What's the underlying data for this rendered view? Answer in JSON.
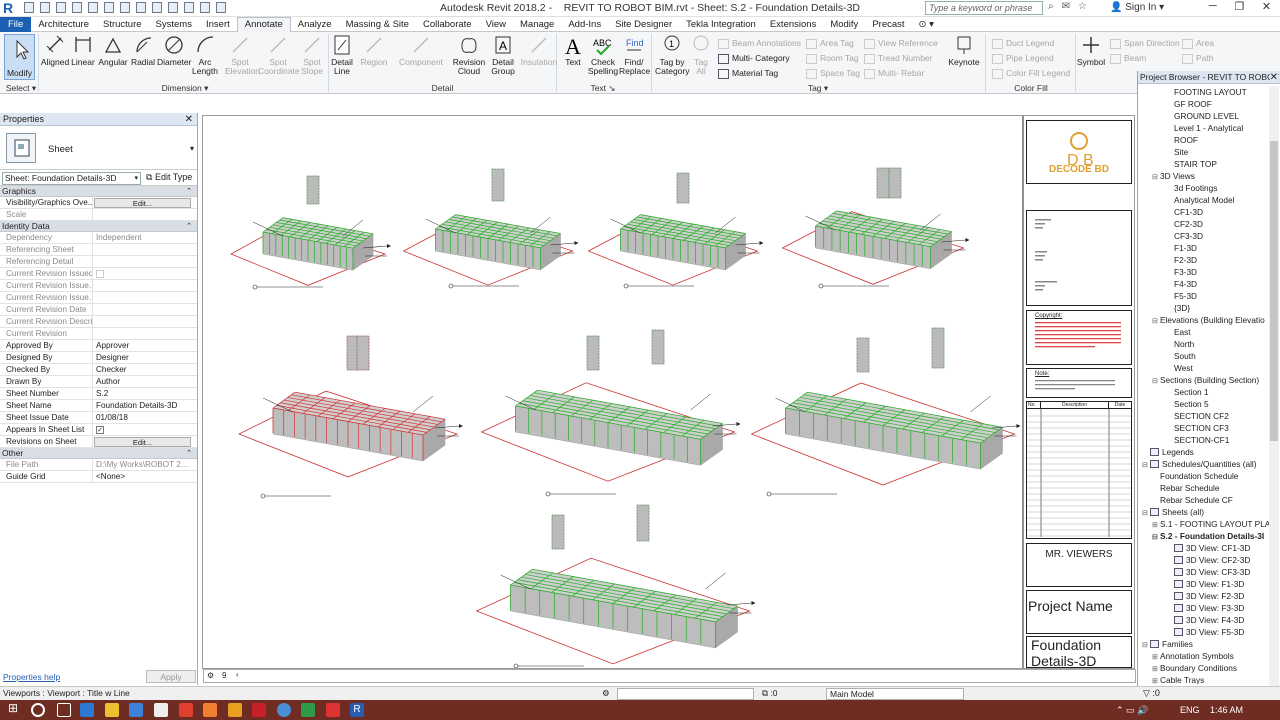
{
  "window": {
    "app_title": "Autodesk Revit 2018.2 -",
    "doc_title": "REVIT TO ROBOT BIM.rvt - Sheet: S.2 - Foundation Details-3D",
    "search_placeholder": "Type a keyword or phrase",
    "sign_in": "Sign In"
  },
  "menu": [
    "File",
    "Architecture",
    "Structure",
    "Systems",
    "Insert",
    "Annotate",
    "Analyze",
    "Massing & Site",
    "Collaborate",
    "View",
    "Manage",
    "Add-Ins",
    "Site Designer",
    "Tekla Integration",
    "Extensions",
    "Modify",
    "Precast"
  ],
  "ribbon": {
    "modify": "Modify",
    "select": "Select",
    "dimension": [
      "Aligned",
      "Linear",
      "Angular",
      "Radial",
      "Diameter",
      "Arc Length",
      "Spot Elevation",
      "Spot Coordinate",
      "Spot Slope"
    ],
    "dimension_group": "Dimension",
    "detail": [
      "Detail Line",
      "Region",
      "Component",
      "Revision Cloud",
      "Detail Group",
      "Insulation"
    ],
    "detail_group": "Detail",
    "text": [
      "Text",
      "Check Spelling",
      "Find/ Replace"
    ],
    "text_group": "Text",
    "tag": [
      "Tag by Category",
      "Tag All",
      "Beam Annotations",
      "Multi- Category",
      "Material Tag",
      "Area Tag",
      "Room Tag",
      "Space Tag",
      "View Reference",
      "Tread Number",
      "Multi- Rebar"
    ],
    "tag_group": "Tag",
    "keynote": "Keynote",
    "colorfill": [
      "Duct Legend",
      "Pipe Legend",
      "Color Fill Legend"
    ],
    "colorfill_group": "Color Fill",
    "symbol": [
      "Symbol",
      "Span Direction",
      "Beam",
      "Area",
      "Path"
    ]
  },
  "properties": {
    "title": "Properties",
    "type_name": "Sheet",
    "selector": "Sheet: Foundation Details-3D",
    "edit_type": "Edit Type",
    "sections": {
      "graphics": "Graphics",
      "identity": "Identity Data",
      "other": "Other"
    },
    "graphics_rows": [
      {
        "k": "Visibility/Graphics Ove...",
        "v": "Edit..."
      },
      {
        "k": "Scale",
        "v": ""
      }
    ],
    "identity_rows": [
      {
        "k": "Dependency",
        "v": "Independent"
      },
      {
        "k": "Referencing Sheet",
        "v": ""
      },
      {
        "k": "Referencing Detail",
        "v": ""
      },
      {
        "k": "Current Revision Issued",
        "v": ""
      },
      {
        "k": "Current Revision Issue...",
        "v": ""
      },
      {
        "k": "Current Revision Issue...",
        "v": ""
      },
      {
        "k": "Current Revision Date",
        "v": ""
      },
      {
        "k": "Current Revision Descri...",
        "v": ""
      },
      {
        "k": "Current Revision",
        "v": ""
      },
      {
        "k": "Approved By",
        "v": "Approver"
      },
      {
        "k": "Designed By",
        "v": "Designer"
      },
      {
        "k": "Checked By",
        "v": "Checker"
      },
      {
        "k": "Drawn By",
        "v": "Author"
      },
      {
        "k": "Sheet Number",
        "v": "S.2"
      },
      {
        "k": "Sheet Name",
        "v": "Foundation Details-3D"
      },
      {
        "k": "Sheet Issue Date",
        "v": "01/08/18"
      },
      {
        "k": "Appears In Sheet List",
        "v": "✓"
      },
      {
        "k": "Revisions on Sheet",
        "v": "Edit..."
      }
    ],
    "other_rows": [
      {
        "k": "File Path",
        "v": "D:\\My Works\\ROBOT 2..."
      },
      {
        "k": "Guide Grid",
        "v": "<None>"
      }
    ],
    "help": "Properties help",
    "apply": "Apply"
  },
  "titleblock": {
    "company": "DECODE BD",
    "logo_text": "D B",
    "copyright": "Copyright:",
    "note": "Note:",
    "rev_headers": [
      "No.",
      "Description",
      "Date"
    ],
    "client": "MR. VIEWERS",
    "project": "Project Name",
    "sheet_name": "Foundation Details-3D"
  },
  "browser": {
    "title": "Project Browser - REVIT TO ROBOT ...",
    "items": [
      {
        "t": "FOOTING LAYOUT",
        "lv": 3
      },
      {
        "t": "GF ROOF",
        "lv": 3
      },
      {
        "t": "GROUND LEVEL",
        "lv": 3
      },
      {
        "t": "Level 1 - Analytical",
        "lv": 3
      },
      {
        "t": "ROOF",
        "lv": 3
      },
      {
        "t": "Site",
        "lv": 3
      },
      {
        "t": "STAIR TOP",
        "lv": 3
      },
      {
        "t": "3D Views",
        "lv": 2,
        "tg": "⊟"
      },
      {
        "t": "3d Footings",
        "lv": 3
      },
      {
        "t": "Analytical Model",
        "lv": 3
      },
      {
        "t": "CF1-3D",
        "lv": 3
      },
      {
        "t": "CF2-3D",
        "lv": 3
      },
      {
        "t": "CF3-3D",
        "lv": 3
      },
      {
        "t": "F1-3D",
        "lv": 3
      },
      {
        "t": "F2-3D",
        "lv": 3
      },
      {
        "t": "F3-3D",
        "lv": 3
      },
      {
        "t": "F4-3D",
        "lv": 3
      },
      {
        "t": "F5-3D",
        "lv": 3
      },
      {
        "t": "{3D}",
        "lv": 3
      },
      {
        "t": "Elevations (Building Elevatio",
        "lv": 2,
        "tg": "⊟"
      },
      {
        "t": "East",
        "lv": 3
      },
      {
        "t": "North",
        "lv": 3
      },
      {
        "t": "South",
        "lv": 3
      },
      {
        "t": "West",
        "lv": 3
      },
      {
        "t": "Sections (Building Section)",
        "lv": 2,
        "tg": "⊟"
      },
      {
        "t": "Section 1",
        "lv": 3
      },
      {
        "t": "Section 5",
        "lv": 3
      },
      {
        "t": "SECTION CF2",
        "lv": 3
      },
      {
        "t": "SECTION CF3",
        "lv": 3
      },
      {
        "t": "SECTION-CF1",
        "lv": 3
      },
      {
        "t": "Legends",
        "lv": 1,
        "tg": "",
        "ic": true
      },
      {
        "t": "Schedules/Quantities (all)",
        "lv": 1,
        "tg": "⊟",
        "ic": true
      },
      {
        "t": "Foundation Schedule",
        "lv": 2
      },
      {
        "t": "Rebar Schedule",
        "lv": 2
      },
      {
        "t": "Rebar Schedule CF",
        "lv": 2
      },
      {
        "t": "Sheets (all)",
        "lv": 1,
        "tg": "⊟",
        "ic": true
      },
      {
        "t": "S.1 - FOOTING LAYOUT PLA",
        "lv": 2,
        "tg": "⊞"
      },
      {
        "t": "S.2 - Foundation Details-3I",
        "lv": 2,
        "tg": "⊟",
        "b": true
      },
      {
        "t": "3D View: CF1-3D",
        "lv": 3,
        "ic": true
      },
      {
        "t": "3D View: CF2-3D",
        "lv": 3,
        "ic": true
      },
      {
        "t": "3D View: CF3-3D",
        "lv": 3,
        "ic": true
      },
      {
        "t": "3D View: F1-3D",
        "lv": 3,
        "ic": true
      },
      {
        "t": "3D View: F2-3D",
        "lv": 3,
        "ic": true
      },
      {
        "t": "3D View: F3-3D",
        "lv": 3,
        "ic": true
      },
      {
        "t": "3D View: F4-3D",
        "lv": 3,
        "ic": true
      },
      {
        "t": "3D View: F5-3D",
        "lv": 3,
        "ic": true
      },
      {
        "t": "Families",
        "lv": 1,
        "tg": "⊟",
        "ic": true
      },
      {
        "t": "Annotation Symbols",
        "lv": 2,
        "tg": "⊞"
      },
      {
        "t": "Boundary Conditions",
        "lv": 2,
        "tg": "⊞"
      },
      {
        "t": "Cable Trays",
        "lv": 2,
        "tg": "⊞"
      }
    ]
  },
  "status": {
    "text": "Viewports : Viewport : Title w Line",
    "zero": ":0",
    "model": "Main Model",
    "scale_val": "9"
  },
  "taskbar": {
    "lang": "ENG",
    "time": "1:46 AM"
  },
  "colors": {
    "accent": "#1b60b3",
    "rebar_green": "#22b022",
    "rebar_red": "#d83030",
    "taskbar": "#6f2c22"
  }
}
